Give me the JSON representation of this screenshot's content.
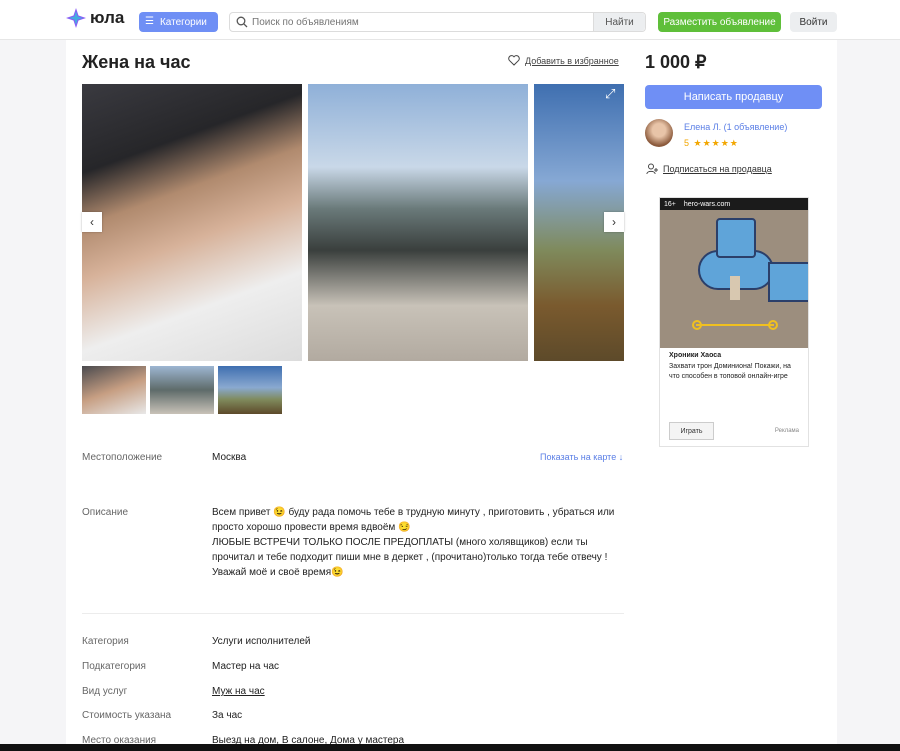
{
  "header": {
    "logo_text": "юла",
    "categories_label": "Категории",
    "search_placeholder": "Поиск по объявлениям",
    "search_button": "Найти",
    "post_ad_button": "Разместить объявление",
    "login_button": "Войти"
  },
  "listing": {
    "title": "Жена на час",
    "favorite_label": "Добавить в избранное",
    "location_label": "Местоположение",
    "location_value": "Москва",
    "map_link": "Показать на карте ↓",
    "description_label": "Описание",
    "description_lines": [
      "Всем привет 😉 буду рада помочь тебе в трудную минуту , приготовить , убраться или просто хорошо провести время вдвоём 😏",
      "ЛЮБЫЕ ВСТРЕЧИ ТОЛЬКО ПОСЛЕ ПРЕДОПЛАТЫ (много холявщиков) если ты прочитал и тебе подходит пиши мне в деркет , (прочитано)только тогда тебе отвечу !",
      "Уважай моё и своё время😉"
    ],
    "params": [
      {
        "label": "Категория",
        "value": "Услуги исполнителей"
      },
      {
        "label": "Подкатегория",
        "value": "Мастер на час"
      },
      {
        "label": "Вид услуг",
        "value": "Муж на час"
      },
      {
        "label": "Стоимость указана",
        "value": "За час"
      },
      {
        "label": "Место оказания",
        "value": "Выезд на дом, В салоне, Дома у мастера"
      }
    ]
  },
  "sidebar": {
    "price": "1 000 ₽",
    "write_button": "Написать продавцу",
    "seller_name": "Елена Л. (1 объявление)",
    "rating_value": "5",
    "rating_stars": "★★★★★",
    "subscribe_label": "Подписаться на продавца"
  },
  "ad": {
    "age_badge": "16+",
    "domain": "hero-wars.com",
    "title": "Хроники Хаоса",
    "text": "Захвати трон Доминиона! Покажи, на что способен в топовой онлайн-игре",
    "play_button": "Играть",
    "label": "Реклама"
  },
  "colors": {
    "accent": "#6f8ff5",
    "green": "#5fbf3a",
    "link": "#5b7fe6",
    "star": "#f2a600"
  }
}
